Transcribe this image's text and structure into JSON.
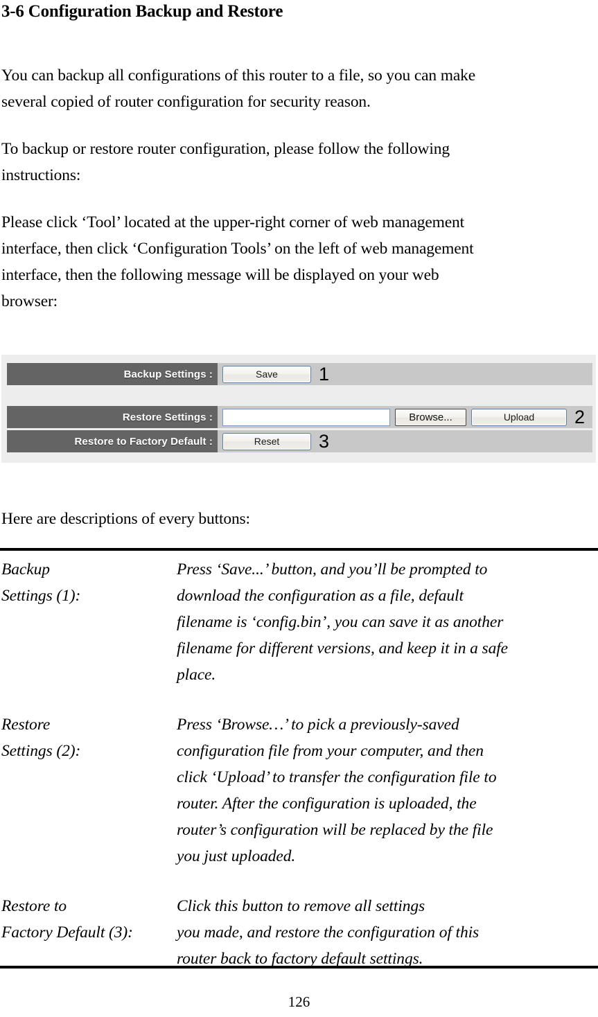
{
  "document": {
    "heading": "3-6 Configuration Backup and Restore",
    "page_number": "126",
    "paragraphs": {
      "intro": [
        "You can backup all configurations of this router to a file, so you can make",
        "several copied of router configuration for security reason."
      ],
      "howto": [
        "To backup or restore router configuration, please follow the following",
        "instructions:"
      ],
      "click": [
        "Please click ‘Tool’ located at the upper-right corner of web management",
        "interface, then click ‘Configuration Tools’ on the left of web management",
        "interface, then the following message will be displayed on your web",
        "browser:"
      ],
      "descriptions_intro": [
        "Here are descriptions of every buttons:"
      ]
    }
  },
  "ui_panel": {
    "colors": {
      "panel_background": "#ededed",
      "label_cell": "#646464",
      "value_cell": "#c8c8c8",
      "label_text": "#ffffff",
      "button_border": "#5f7fa5",
      "input_border": "#7a9ac0"
    },
    "rows": [
      {
        "label": "Backup Settings :",
        "button": "Save",
        "callout": "1"
      },
      {
        "label": "Restore Settings :",
        "input_value": "",
        "input_placeholder": "",
        "browse_button": "Browse...",
        "button": "Upload",
        "callout": "2"
      },
      {
        "label": "Restore to Factory Default :",
        "button": "Reset",
        "callout": "3"
      }
    ]
  },
  "descriptions": [
    {
      "term": [
        "Backup",
        "Settings (1):"
      ],
      "body": [
        "Press ‘Save...’ button, and you’ll be prompted to",
        "download the configuration as a file, default",
        "filename is ‘config.bin’, you can save it as another",
        "filename for different versions, and keep it in a safe",
        "place."
      ]
    },
    {
      "term": [
        "Restore",
        "Settings (2):"
      ],
      "body": [
        "Press ‘Browse…’ to pick a previously-saved",
        "configuration file from your computer, and then",
        "click ‘Upload’ to transfer the configuration file to",
        "router. After the configuration is uploaded, the",
        "router’s configuration will be replaced by the file",
        "you just uploaded."
      ]
    },
    {
      "term": [
        "Restore to",
        "Factory Default (3):"
      ],
      "body": [
        "Click this button to remove all settings",
        "you made, and restore the configuration of this",
        "router back to factory default settings."
      ]
    }
  ]
}
